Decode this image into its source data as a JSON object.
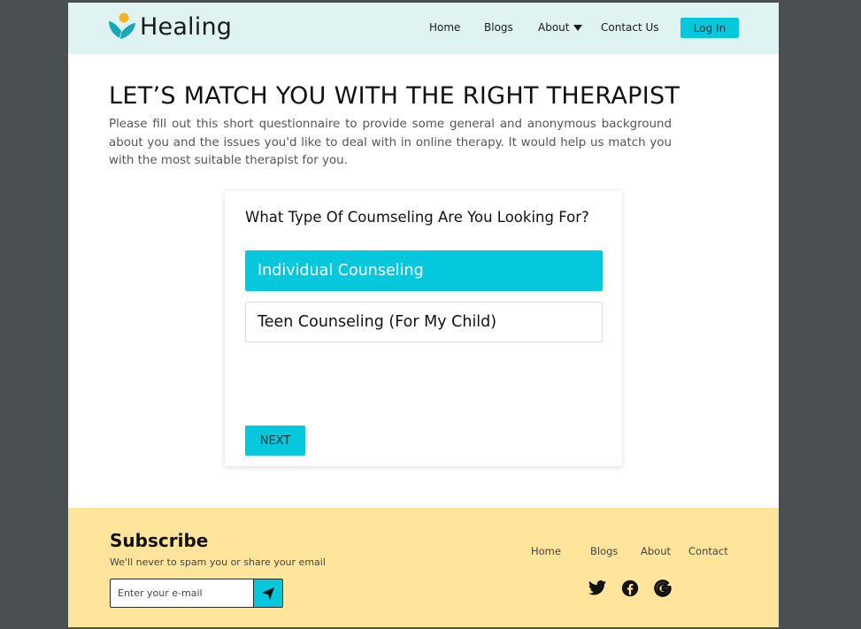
{
  "header": {
    "brand": "Healing",
    "nav": {
      "home": "Home",
      "blogs": "Blogs",
      "about": "About",
      "contact": "Contact Us"
    },
    "login_label": "Log In"
  },
  "main": {
    "title": "LET’S MATCH YOU WITH THE RIGHT THERAPIST",
    "intro": "Please fill out this short questionnaire to provide some general and anonymous background about you and the issues you'd like to deal with in online therapy. It would help us match you with the most suitable therapist for you.",
    "question": "What Type Of Coumseling Are You Looking For?",
    "options": [
      {
        "label": "Individual Counseling",
        "selected": true
      },
      {
        "label": "Teen Counseling (For My Child)",
        "selected": false
      }
    ],
    "next_label": "NEXT"
  },
  "footer": {
    "subscribe_title": "Subscribe",
    "subscribe_text": "We'll never to spam you or share your email",
    "email_placeholder": "Enter your e-mail",
    "links": {
      "home": "Home",
      "blogs": "Blogs",
      "about": "About",
      "contact": "Contact"
    },
    "social_icons": [
      "twitter-icon",
      "facebook-icon",
      "google-icon"
    ]
  },
  "colors": {
    "accent": "#06c8dd",
    "header_bg": "#dff3f3",
    "footer_bg": "#ffe59c",
    "logo_orange": "#f5b324",
    "logo_teal": "#18a9b8"
  }
}
